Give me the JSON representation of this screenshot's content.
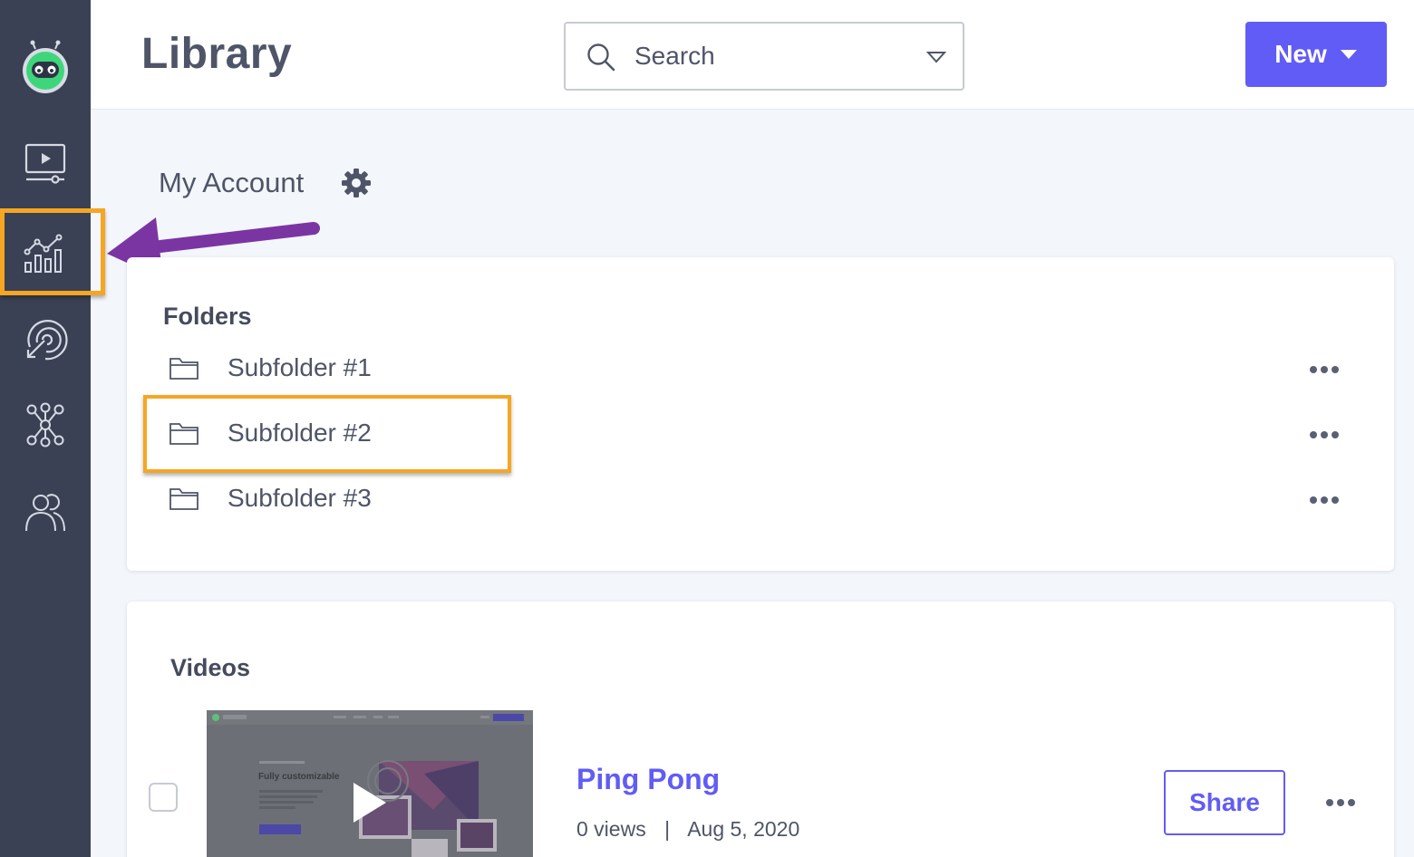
{
  "header": {
    "title": "Library",
    "search_placeholder": "Search",
    "new_label": "New"
  },
  "sidebar": {
    "items": [
      {
        "name": "videos",
        "icon": "video-screen-icon"
      },
      {
        "name": "analytics",
        "icon": "analytics-icon",
        "highlighted": true
      },
      {
        "name": "integrations",
        "icon": "target-icon"
      },
      {
        "name": "hub",
        "icon": "network-icon"
      },
      {
        "name": "users",
        "icon": "users-icon"
      }
    ]
  },
  "account": {
    "title": "My Account"
  },
  "folders": {
    "title": "Folders",
    "items": [
      {
        "name": "Subfolder #1"
      },
      {
        "name": "Subfolder #2",
        "highlighted": true
      },
      {
        "name": "Subfolder #3"
      }
    ]
  },
  "videos": {
    "title": "Videos",
    "items": [
      {
        "title": "Ping Pong",
        "views": "0 views",
        "separator": "|",
        "date": "Aug 5, 2020",
        "share_label": "Share",
        "thumb_text": "Fully customizable"
      }
    ]
  },
  "colors": {
    "sidebar": "#3a4154",
    "accent": "#615cf5",
    "highlight": "#f5a623",
    "arrow": "#7b35a3",
    "logo": "#3ed67a"
  }
}
